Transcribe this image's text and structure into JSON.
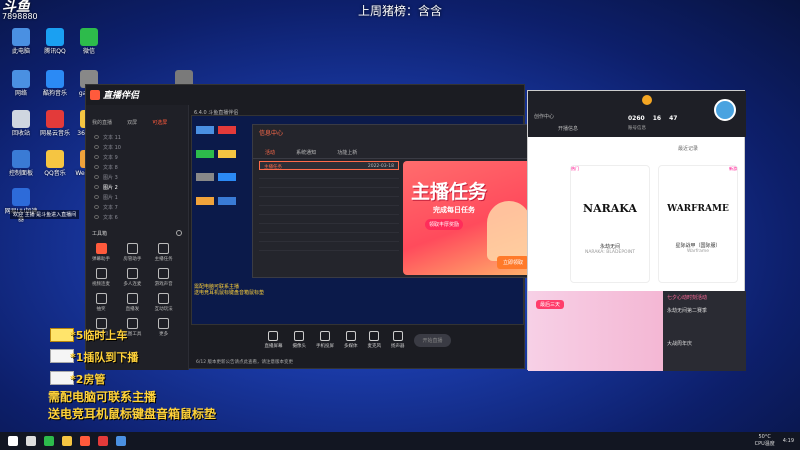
{
  "stream": {
    "top_title": "上周猪榜：含含",
    "logo_top": "斗鱼",
    "logo_id": "7898880"
  },
  "desktop_icons": [
    {
      "label": "此电脑",
      "color": "#4a90e2"
    },
    {
      "label": "腾讯QQ",
      "color": "#1aa0f2"
    },
    {
      "label": "微信",
      "color": "#2dbb4b"
    },
    {
      "label": "网络",
      "color": "#4a90e2"
    },
    {
      "label": "酷狗音乐",
      "color": "#2b8af5"
    },
    {
      "label": "games",
      "color": "#888888"
    },
    {
      "label": "who is there",
      "color": "#7a7a7a"
    },
    {
      "label": "回收站",
      "color": "#cfd6e0"
    },
    {
      "label": "网易云音乐",
      "color": "#e33a3a"
    },
    {
      "label": "360极速",
      "color": "#f5c542"
    },
    {
      "label": "控制面板",
      "color": "#3a7bd5"
    },
    {
      "label": "QQ音乐",
      "color": "#f5c542"
    },
    {
      "label": "WeGame",
      "color": "#f0a33b"
    },
    {
      "label": "网易UU加速器",
      "color": "#2d6bd9"
    }
  ],
  "app_window": {
    "title": "直播伴侣",
    "tabs": [
      "我的直播",
      "双屏",
      "可选屏"
    ],
    "layers": [
      "文本 11",
      "文本 10",
      "文本 9",
      "文本 8",
      "图片 3",
      "图片 2",
      "图片 1",
      "文本 7",
      "文本 6"
    ],
    "welcome_text": "欢迎 主播 是斗鱼进入直播间",
    "toolbox_title": "工具箱",
    "tools": [
      "弹幕助手",
      "房管助手",
      "主播任务",
      "视频连麦",
      "多人连麦",
      "游戏声音",
      "抽奖",
      "直播发",
      "互动玩法",
      "直播间",
      "截图工具",
      "更多"
    ],
    "preview_title": "6.4.0 斗鱼直播伴侣",
    "bottom_items": [
      "直播屏幕",
      "摄像头",
      "手机投屏",
      "多媒体",
      "麦克风",
      "扬声器"
    ],
    "start_label": "开始直播",
    "footer_note": "6/12 版本更新公告请点此查看，请注意版本变更"
  },
  "message_center": {
    "title": "信息中心",
    "tabs": [
      "活动",
      "系统通知",
      "功能上新"
    ],
    "rows": [
      {
        "label": "主播任务",
        "date": "2022-03-18"
      }
    ],
    "promo": {
      "title": "主播任务",
      "subtitle": "完成每日任务",
      "tag": "领取丰厚奖励",
      "button": "立即领取"
    }
  },
  "right_window": {
    "top_labels": [
      "创作中心",
      "开播信息",
      "账号信息"
    ],
    "count": "0260",
    "count2": "16",
    "count3": "47",
    "history": "最近记录",
    "cards": [
      {
        "name": "永劫无间",
        "sub": "NARAKA: BLADEPOINT",
        "logo": "NARAKA",
        "tag": "热门"
      },
      {
        "name": "星际战甲（国际服）",
        "sub": "Warframe",
        "logo": "WARFRAME",
        "tag": "新游"
      }
    ],
    "banner_tag": "最后三天",
    "banner_items": [
      "七夕心动时刻活动",
      "永劫无间第二赛季",
      "大战周年庆"
    ]
  },
  "overlay": {
    "line1": "*5临时上车",
    "line2": "*1插队到下播",
    "line3": "*2房管",
    "line4": "需配电脑可联系主播",
    "line5": "送电竞耳机鼠标键盘音箱鼠标垫",
    "small1": "需配电脑可联系主播",
    "small2": "送电竞耳机鼠标键盘音箱鼠标垫"
  },
  "taskbar": {
    "temp": "50°C",
    "cpu": "CPU温度",
    "time": "4:19"
  }
}
